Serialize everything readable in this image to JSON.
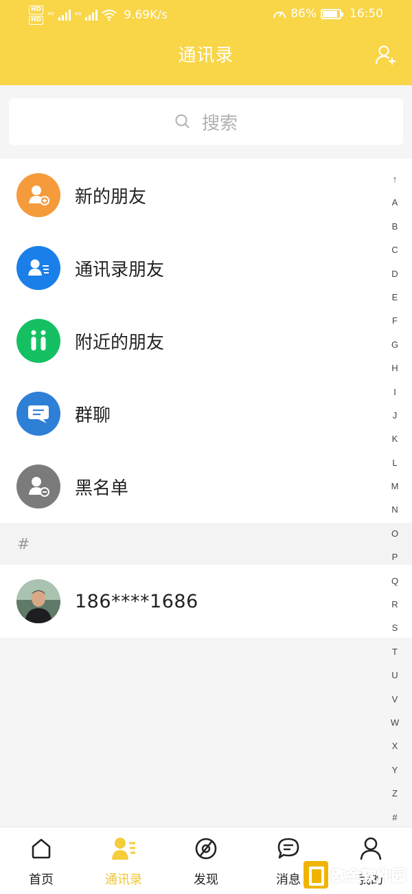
{
  "status_bar": {
    "network_speed": "9.69K/s",
    "battery": "86%",
    "battery_level": 0.86,
    "time": "16:50",
    "hd1": "HD",
    "hd2": "HD",
    "net1": "⁴⁶",
    "net2": "⁴⁶"
  },
  "header": {
    "title": "通讯录",
    "add_icon": "add-user-icon"
  },
  "search": {
    "placeholder": "搜索",
    "icon": "search-icon"
  },
  "functions": [
    {
      "label": "新的朋友",
      "icon": "new-friend-icon",
      "color": "#f59b3c"
    },
    {
      "label": "通讯录朋友",
      "icon": "contacts-friend-icon",
      "color": "#1a7fe8"
    },
    {
      "label": "附近的朋友",
      "icon": "nearby-friend-icon",
      "color": "#15c063"
    },
    {
      "label": "群聊",
      "icon": "group-chat-icon",
      "color": "#2e7fd6"
    },
    {
      "label": "黑名单",
      "icon": "blacklist-icon",
      "color": "#7b7b7b"
    }
  ],
  "section": {
    "header": "#"
  },
  "contacts": [
    {
      "name": "186****1686"
    }
  ],
  "alpha_index": [
    "↑",
    "A",
    "B",
    "C",
    "D",
    "E",
    "F",
    "G",
    "H",
    "I",
    "J",
    "K",
    "L",
    "M",
    "N",
    "O",
    "P",
    "Q",
    "R",
    "S",
    "T",
    "U",
    "V",
    "W",
    "X",
    "Y",
    "Z",
    "#"
  ],
  "tabs": [
    {
      "label": "首页",
      "icon": "home-icon",
      "active": false
    },
    {
      "label": "通讯录",
      "icon": "contacts-icon",
      "active": true
    },
    {
      "label": "发现",
      "icon": "discover-icon",
      "active": false
    },
    {
      "label": "消息",
      "icon": "message-icon",
      "active": false
    },
    {
      "label": "我的",
      "icon": "profile-icon",
      "active": false
    }
  ],
  "watermark": {
    "text": "欧金软件园"
  },
  "colors": {
    "header": "#f9d548",
    "active_tab": "#f0c52e"
  }
}
